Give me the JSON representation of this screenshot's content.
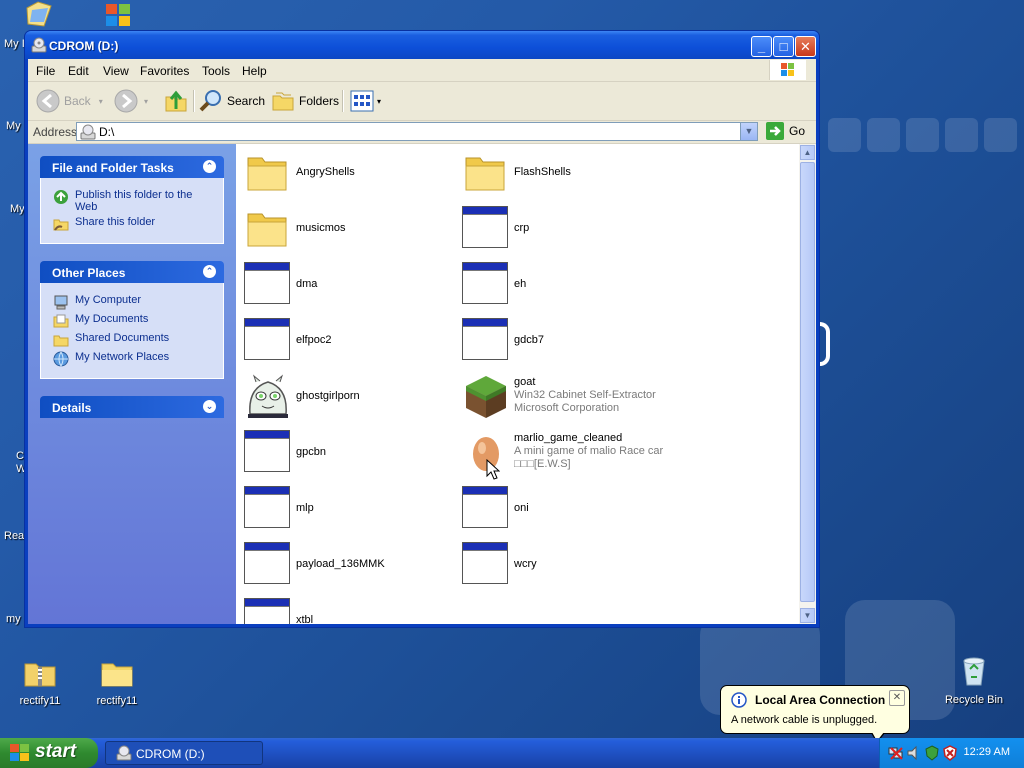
{
  "desktop": {
    "edge_labels": [
      "My I",
      "My",
      "My",
      "C\nW",
      "Rea",
      "my"
    ],
    "icons": [
      {
        "label": "rectify11",
        "icon": "zip-folder-icon"
      },
      {
        "label": "rectify11",
        "icon": "folder-icon"
      },
      {
        "label": "Recycle Bin",
        "icon": "recycle-bin-icon"
      }
    ]
  },
  "window": {
    "title": "CDROM (D:)",
    "menu": [
      "File",
      "Edit",
      "View",
      "Favorites",
      "Tools",
      "Help"
    ],
    "toolbar": {
      "back": "Back",
      "search": "Search",
      "folders": "Folders"
    },
    "address": {
      "label": "Address",
      "value": "D:\\",
      "go": "Go"
    }
  },
  "tasks": {
    "file_folder": {
      "title": "File and Folder Tasks",
      "items": [
        "Publish this folder to the Web",
        "Share this folder"
      ]
    },
    "other_places": {
      "title": "Other Places",
      "items": [
        "My Computer",
        "My Documents",
        "Shared Documents",
        "My Network Places"
      ]
    },
    "details": {
      "title": "Details"
    }
  },
  "files": [
    {
      "name": "AngryShells",
      "type": "folder"
    },
    {
      "name": "FlashShells",
      "type": "folder"
    },
    {
      "name": "musicmos",
      "type": "folder"
    },
    {
      "name": "crp",
      "type": "exe"
    },
    {
      "name": "dma",
      "type": "exe"
    },
    {
      "name": "eh",
      "type": "exe"
    },
    {
      "name": "elfpoc2",
      "type": "exe"
    },
    {
      "name": "gdcb7",
      "type": "exe"
    },
    {
      "name": "ghostgirlporn",
      "type": "ghost"
    },
    {
      "name": "goat",
      "type": "grass",
      "line2": "Win32 Cabinet Self-Extractor",
      "line3": "Microsoft Corporation"
    },
    {
      "name": "gpcbn",
      "type": "exe"
    },
    {
      "name": "marlio_game_cleaned",
      "type": "egg",
      "line2": "A mini game of malio Race car",
      "line3": "□□□[E.W.S]"
    },
    {
      "name": "mlp",
      "type": "exe"
    },
    {
      "name": "oni",
      "type": "exe"
    },
    {
      "name": "payload_136MMK",
      "type": "exe"
    },
    {
      "name": "wcry",
      "type": "exe"
    },
    {
      "name": "xtbl",
      "type": "exe"
    }
  ],
  "taskbar": {
    "start": "start",
    "task": "CDROM (D:)",
    "clock": "12:29 AM"
  },
  "balloon": {
    "title": "Local Area Connection",
    "message": "A network cable is unplugged."
  },
  "colors": {
    "titlebar": "#0d4fd8",
    "taskbar": "#245edb",
    "start": "#2f8a2f",
    "link": "#0c2f8f"
  }
}
